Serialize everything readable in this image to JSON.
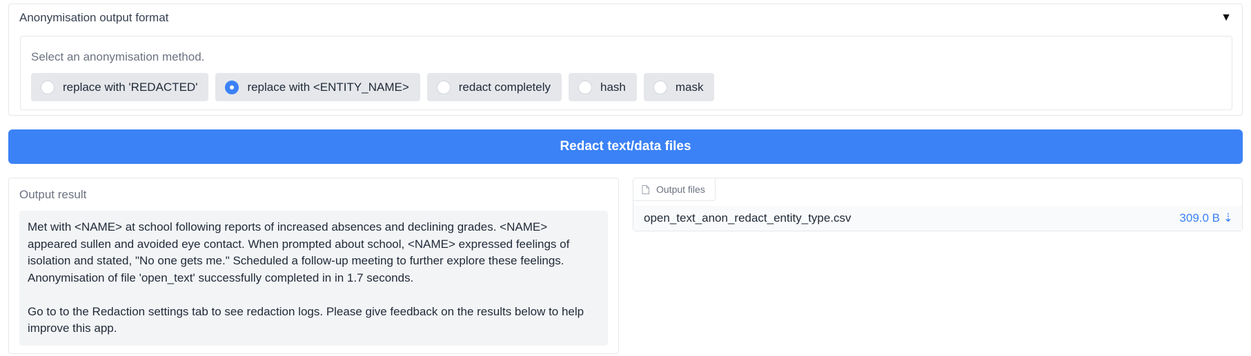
{
  "accordion": {
    "title": "Anonymisation output format",
    "toggle_glyph": "▼"
  },
  "anon_method": {
    "label": "Select an anonymisation method.",
    "options": [
      {
        "label": "replace with 'REDACTED'",
        "selected": false
      },
      {
        "label": "replace with <ENTITY_NAME>",
        "selected": true
      },
      {
        "label": "redact completely",
        "selected": false
      },
      {
        "label": "hash",
        "selected": false
      },
      {
        "label": "mask",
        "selected": false
      }
    ]
  },
  "redact_button": {
    "label": "Redact text/data files"
  },
  "output_result": {
    "label": "Output result",
    "text": "Met with <NAME> at school following reports of increased absences and declining grades. <NAME> appeared sullen and avoided eye contact. When prompted about school, <NAME> expressed feelings of isolation and stated, \"No one gets me.\" Scheduled a follow-up meeting to further explore these feelings.\nAnonymisation of file 'open_text' successfully completed in in 1.7 seconds.\n\nGo to to the Redaction settings tab to see redaction logs. Please give feedback on the results below to help improve this app."
  },
  "output_files": {
    "tab_label": "Output files",
    "tab_icon": "file-icon",
    "files": [
      {
        "name": "open_text_anon_redact_entity_type.csv",
        "size": "309.0 B ⇣"
      }
    ]
  },
  "colors": {
    "accent": "#3b82f6",
    "radio_bg": "#e5e7eb",
    "textarea_bg": "#f3f4f6"
  }
}
